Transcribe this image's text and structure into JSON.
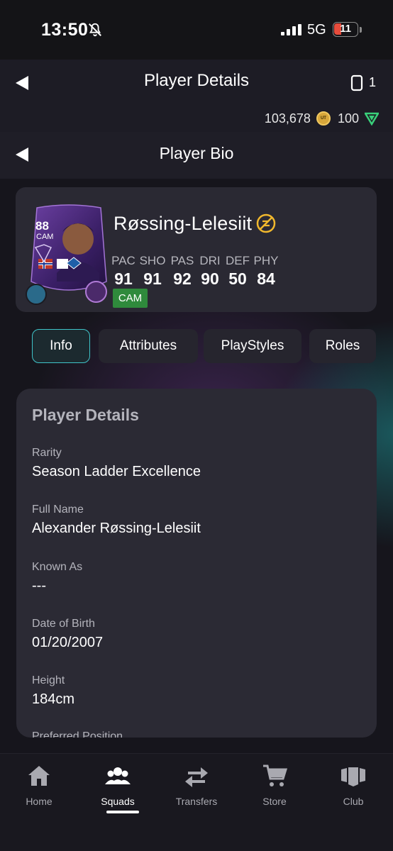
{
  "status_bar": {
    "time": "13:50",
    "network": "5G",
    "battery": "11",
    "bell_icon": "bell-slash-icon",
    "signal_icon": "signal-bars-icon",
    "battery_color": "#e74c3c"
  },
  "header": {
    "title": "Player Details",
    "card_count": "1",
    "coins": "103,678",
    "points": "100",
    "back_icon": "back-arrow-icon"
  },
  "sub_header": {
    "title": "Player Bio"
  },
  "player": {
    "rating": "88",
    "card_position": "CAM",
    "name": "Røssing-Lelesiit",
    "position_badge": "CAM",
    "stats": [
      {
        "label": "PAC",
        "value": "91"
      },
      {
        "label": "SHO",
        "value": "91"
      },
      {
        "label": "PAS",
        "value": "92"
      },
      {
        "label": "DRI",
        "value": "90"
      },
      {
        "label": "DEF",
        "value": "50"
      },
      {
        "label": "PHY",
        "value": "84"
      }
    ],
    "accent_color": "#2f8a3c"
  },
  "tabs": [
    {
      "label": "Info",
      "active": true
    },
    {
      "label": "Attributes",
      "active": false
    },
    {
      "label": "PlayStyles",
      "active": false
    },
    {
      "label": "Roles",
      "active": false
    }
  ],
  "details": {
    "title": "Player Details",
    "fields": [
      {
        "label": "Rarity",
        "value": "Season Ladder Excellence"
      },
      {
        "label": "Full Name",
        "value": "Alexander Røssing-Lelesiit"
      },
      {
        "label": "Known As",
        "value": "---"
      },
      {
        "label": "Date of Birth",
        "value": "01/20/2007"
      },
      {
        "label": "Height",
        "value": "184cm"
      },
      {
        "label": "Preferred Position",
        "value": ""
      }
    ]
  },
  "nav": [
    {
      "label": "Home",
      "icon": "home-icon",
      "active": false
    },
    {
      "label": "Squads",
      "icon": "squads-icon",
      "active": true
    },
    {
      "label": "Transfers",
      "icon": "transfers-icon",
      "active": false
    },
    {
      "label": "Store",
      "icon": "cart-icon",
      "active": false
    },
    {
      "label": "Club",
      "icon": "club-icon",
      "active": false
    }
  ]
}
